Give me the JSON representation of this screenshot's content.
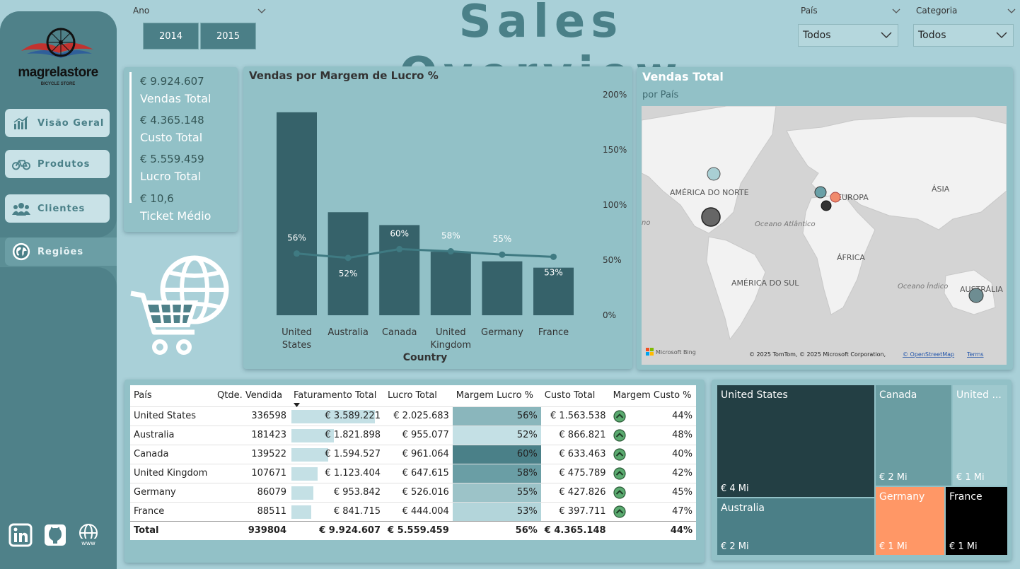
{
  "brand": {
    "name": "magrelastore",
    "tagline": "BICYCLE STORE"
  },
  "nav": {
    "items": [
      {
        "label": "Visão Geral",
        "icon": "chart-icon"
      },
      {
        "label": "Produtos",
        "icon": "bicycle-icon"
      },
      {
        "label": "Clientes",
        "icon": "users-icon"
      },
      {
        "label": "Regiões",
        "icon": "globe-icon",
        "active": true
      }
    ]
  },
  "filters": {
    "ano": {
      "title": "Ano",
      "options": [
        "2014",
        "2015"
      ]
    },
    "pais": {
      "title": "País",
      "value": "Todos"
    },
    "categoria": {
      "title": "Categoria",
      "value": "Todos"
    }
  },
  "header": {
    "title": "Sales Overview"
  },
  "kpis": {
    "vendas": {
      "value": "€ 9.924.607",
      "label": "Vendas Total"
    },
    "custo": {
      "value": "€ 4.365.148",
      "label": "Custo Total"
    },
    "lucro": {
      "value": "€ 5.559.459",
      "label": "Lucro Total"
    },
    "ticket": {
      "value": "€ 10,6",
      "label": "Ticket Médio"
    }
  },
  "chart_data": {
    "type": "bar",
    "title": "Vendas por Margem de Lucro %",
    "xlabel": "Country",
    "ylabel": "",
    "categories": [
      "United States",
      "Australia",
      "Canada",
      "United Kingdom",
      "Germany",
      "France"
    ],
    "category_lines": [
      [
        "United",
        "States"
      ],
      [
        "Australia"
      ],
      [
        "Canada"
      ],
      [
        "United",
        "Kingdom"
      ],
      [
        "Germany"
      ],
      [
        "France"
      ]
    ],
    "series": [
      {
        "values": [
          3589221,
          1821898,
          1594527,
          1123404,
          953842,
          841715
        ],
        "type": "bar",
        "color": "#36626a"
      },
      {
        "values": [
          56,
          52,
          60,
          58,
          55,
          53
        ],
        "type": "line",
        "axis": "right",
        "color": "#3f7a82",
        "labels": [
          "56%",
          "52%",
          "60%",
          "58%",
          "55%",
          "53%"
        ]
      }
    ],
    "y_left_max": 3900000,
    "y_right_ticks": [
      "0%",
      "50%",
      "100%",
      "150%",
      "200%"
    ],
    "y_right_range": [
      0,
      200
    ]
  },
  "map": {
    "title": "Vendas Total",
    "subtitle": "por País",
    "labels": {
      "na": "AMÉRICA DO NORTE",
      "sa": "AMÉRICA DO SUL",
      "eu": "EUROPA",
      "af": "ÁFRICA",
      "as": "ÁSIA",
      "au": "AUSTRÁLIA",
      "atl": "Oceano Atlântico",
      "ind": "Oceano Índico",
      "pac": "no"
    },
    "bing": "Microsoft Bing",
    "attribution": "© 2025 TomTom, © 2025 Microsoft Corporation,",
    "osm": "© OpenStreetMap",
    "terms": "Terms"
  },
  "table": {
    "headers": [
      "País",
      "Qtde. Vendida",
      "Faturamento Total",
      "Lucro Total",
      "Margem Lucro %",
      "Custo Total",
      "Margem Custo %"
    ],
    "rows": [
      {
        "pais": "United States",
        "qtd": "336598",
        "fat": "€ 3.589.221",
        "fat_num": 3589221,
        "lucro": "€ 2.025.683",
        "ml": "56%",
        "ml_num": 56,
        "custo": "€ 1.563.538",
        "mc": "44%"
      },
      {
        "pais": "Australia",
        "qtd": "181423",
        "fat": "€ 1.821.898",
        "fat_num": 1821898,
        "lucro": "€ 955.077",
        "ml": "52%",
        "ml_num": 52,
        "custo": "€ 866.821",
        "mc": "48%"
      },
      {
        "pais": "Canada",
        "qtd": "139522",
        "fat": "€ 1.594.527",
        "fat_num": 1594527,
        "lucro": "€ 961.064",
        "ml": "60%",
        "ml_num": 60,
        "custo": "€ 633.463",
        "mc": "40%"
      },
      {
        "pais": "United Kingdom",
        "qtd": "107671",
        "fat": "€ 1.123.404",
        "fat_num": 1123404,
        "lucro": "€ 647.615",
        "ml": "58%",
        "ml_num": 58,
        "custo": "€ 475.789",
        "mc": "42%"
      },
      {
        "pais": "Germany",
        "qtd": "86079",
        "fat": "€ 953.842",
        "fat_num": 953842,
        "lucro": "€ 526.016",
        "ml": "55%",
        "ml_num": 55,
        "custo": "€ 427.826",
        "mc": "45%"
      },
      {
        "pais": "France",
        "qtd": "88511",
        "fat": "€ 841.715",
        "fat_num": 841715,
        "lucro": "€ 444.004",
        "ml": "53%",
        "ml_num": 53,
        "custo": "€ 397.711",
        "mc": "47%"
      }
    ],
    "total": {
      "label": "Total",
      "qtd": "939804",
      "fat": "€ 9.924.607",
      "lucro": "€ 5.559.459",
      "ml": "56%",
      "custo": "€ 4.365.148",
      "mc": "44%"
    }
  },
  "treemap": {
    "cells": [
      {
        "name": "United States",
        "value": "€ 4 Mi",
        "color": "#233f44"
      },
      {
        "name": "Canada",
        "value": "€ 2 Mi",
        "color": "#6a9da2"
      },
      {
        "name": "United ...",
        "value": "€ 1 Mi",
        "color": "#9fc9ce"
      },
      {
        "name": "Australia",
        "value": "€ 2 Mi",
        "color": "#4b7f87"
      },
      {
        "name": "Germany",
        "value": "€ 1 Mi",
        "color": "#ff9766"
      },
      {
        "name": "France",
        "value": "€ 1 Mi",
        "color": "#000000"
      }
    ]
  }
}
